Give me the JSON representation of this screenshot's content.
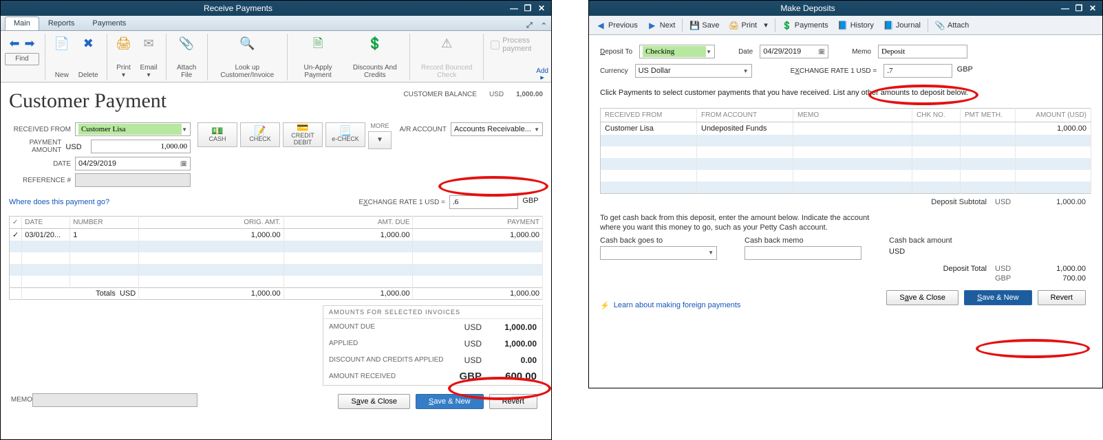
{
  "window1": {
    "title": "Receive Payments",
    "tabs": {
      "main": "Main",
      "reports": "Reports",
      "payments": "Payments"
    },
    "ribbon": {
      "find": "Find",
      "new": "New",
      "delete": "Delete",
      "print": "Print",
      "email": "Email",
      "attach": "Attach File",
      "lookup": "Look up Customer/Invoice",
      "unapply": "Un-Apply Payment",
      "discounts": "Discounts And Credits",
      "record": "Record Bounced Check",
      "process": "Process payment",
      "add": "Add"
    },
    "heading": "Customer Payment",
    "balance": {
      "label": "CUSTOMER BALANCE",
      "currency": "USD",
      "value": "1,000.00"
    },
    "form": {
      "received_from_label": "RECEIVED FROM",
      "received_from": "Customer Lisa",
      "amount_label": "PAYMENT AMOUNT",
      "amount_currency": "USD",
      "amount": "1,000.00",
      "date_label": "DATE",
      "date": "04/29/2019",
      "ref_label": "REFERENCE #",
      "link": "Where does this payment go?",
      "ar_label": "A/R ACCOUNT",
      "ar_value": "Accounts Receivable...",
      "more": "MORE",
      "cash": "CASH",
      "check": "CHECK",
      "credit": "CREDIT\nDEBIT",
      "echeck": "e-CHECK",
      "ex_label": "EXCHANGE RATE 1 USD =",
      "ex_rate": ".6",
      "ex_cur": "GBP"
    },
    "table": {
      "h": {
        "chk": "✓",
        "date": "DATE",
        "number": "NUMBER",
        "orig": "ORIG. AMT.",
        "due": "AMT. DUE",
        "payment": "PAYMENT"
      },
      "r": {
        "date": "03/01/20...",
        "number": "1",
        "orig": "1,000.00",
        "due": "1,000.00",
        "payment": "1,000.00"
      },
      "tot": {
        "label": "Totals",
        "cur": "USD",
        "orig": "1,000.00",
        "due": "1,000.00",
        "payment": "1,000.00"
      }
    },
    "amounts": {
      "title": "AMOUNTS FOR SELECTED INVOICES",
      "due": {
        "k": "AMOUNT DUE",
        "c": "USD",
        "v": "1,000.00"
      },
      "applied": {
        "k": "APPLIED",
        "c": "USD",
        "v": "1,000.00"
      },
      "disc": {
        "k": "DISCOUNT AND CREDITS APPLIED",
        "c": "USD",
        "v": "0.00"
      },
      "recv": {
        "k": "AMOUNT RECEIVED",
        "c": "GBP",
        "v": "600.00"
      }
    },
    "memo": "MEMO",
    "buttons": {
      "save_close": "Save & Close",
      "save_new": "Save & New",
      "revert": "Revert"
    }
  },
  "window2": {
    "title": "Make Deposits",
    "toolbar": {
      "previous": "Previous",
      "next": "Next",
      "save": "Save",
      "print": "Print",
      "payments": "Payments",
      "history": "History",
      "journal": "Journal",
      "attach": "Attach"
    },
    "f": {
      "deposit_to_label": "Deposit To",
      "deposit_to": "Checking",
      "date_label": "Date",
      "date": "04/29/2019",
      "memo_label": "Memo",
      "memo": "Deposit",
      "currency_label": "Currency",
      "currency": "US Dollar",
      "ex_label": "EXCHANGE RATE 1 USD =",
      "ex_rate": ".7",
      "ex_cur": "GBP"
    },
    "hint": "Click Payments to select customer payments that you have received. List any other amounts to deposit below.",
    "table": {
      "h": {
        "from": "RECEIVED FROM",
        "acct": "FROM ACCOUNT",
        "memo": "MEMO",
        "chk": "CHK NO.",
        "meth": "PMT METH.",
        "amt": "AMOUNT (USD)"
      },
      "r": {
        "from": "Customer Lisa",
        "acct": "Undeposited Funds",
        "amt": "1,000.00"
      }
    },
    "sub": {
      "label": "Deposit Subtotal",
      "cur": "USD",
      "val": "1,000.00"
    },
    "note1": "To get cash back from this deposit, enter the amount below.  Indicate the account",
    "note2": "where you want this money to go, such as your Petty Cash account.",
    "cb": {
      "goes": "Cash back goes to",
      "memo": "Cash back memo",
      "amount": "Cash back amount",
      "cur": "USD"
    },
    "tot": {
      "label": "Deposit Total",
      "l1c": "USD",
      "l1v": "1,000.00",
      "l2c": "GBP",
      "l2v": "700.00"
    },
    "learn": "Learn about making foreign payments",
    "buttons": {
      "save_close": "Save & Close",
      "save_new": "Save & New",
      "revert": "Revert"
    }
  }
}
